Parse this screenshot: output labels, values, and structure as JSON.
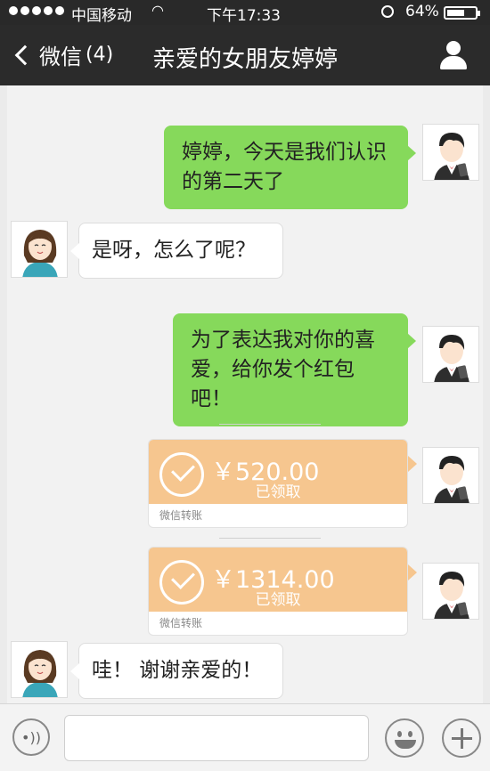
{
  "status_bar": {
    "carrier": "中国移动",
    "time": "下午17:33",
    "battery": "64%",
    "battery_level": 0.64
  },
  "nav": {
    "back_label": "微信",
    "unread_count": "(4)",
    "title": "亲爱的女朋友婷婷"
  },
  "messages": [
    {
      "sender": "me",
      "text": "婷婷，今天是我们认识的第二天了"
    },
    {
      "sender": "her",
      "text": "是呀，怎么了呢？"
    },
    {
      "sender": "me",
      "text": "为了表达我对你的喜爱，给你发个红包吧！"
    },
    {
      "sender": "me",
      "type": "transfer",
      "amount": "￥520.00",
      "status": "已领取",
      "footer": "微信转账"
    },
    {
      "sender": "me",
      "type": "transfer",
      "amount": "￥1314.00",
      "status": "已领取",
      "footer": "微信转账"
    },
    {
      "sender": "her",
      "text": "哇！ 谢谢亲爱的！"
    }
  ],
  "colors": {
    "my_bubble": "#86d95b",
    "transfer_card": "#f6c68f",
    "nav_bar": "#2b2b2b"
  }
}
